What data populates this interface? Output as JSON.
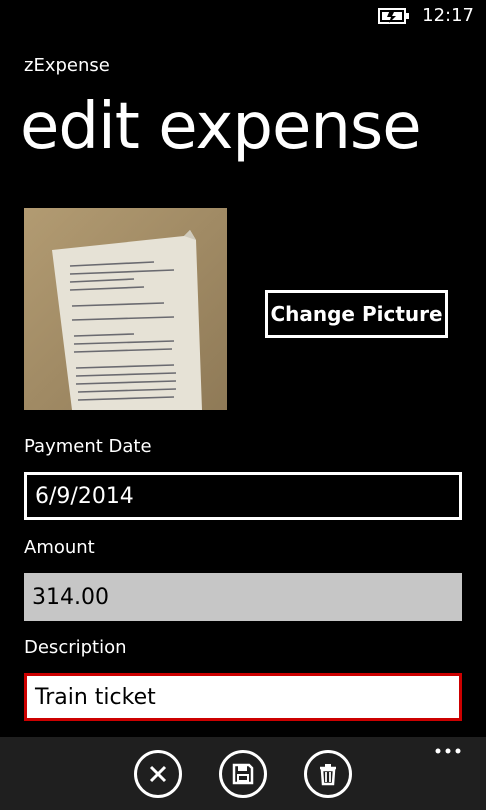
{
  "status_bar": {
    "battery_icon": "battery-charging-icon",
    "time": "12:17"
  },
  "app": {
    "name": "zExpense",
    "page_title": "edit expense"
  },
  "receipt": {
    "change_picture_label": "Change Picture"
  },
  "form": {
    "payment_date_label": "Payment Date",
    "payment_date_value": "6/9/2014",
    "amount_label": "Amount",
    "amount_value": "314.00",
    "description_label": "Description",
    "description_value": "Train ticket"
  },
  "app_bar": {
    "buttons": [
      "cancel-icon",
      "save-icon",
      "delete-icon"
    ],
    "more_icon": "more-options-icon"
  },
  "colors": {
    "background": "#000000",
    "field_disabled": "#c6c6c6",
    "focus_border": "#cc0000",
    "app_bar": "#1f1f1f"
  }
}
